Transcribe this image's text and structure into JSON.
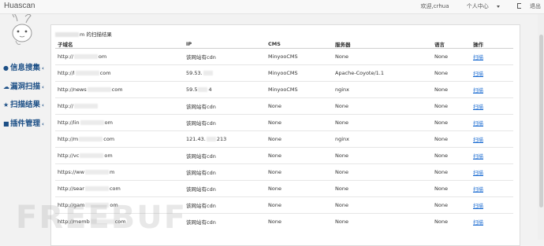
{
  "navbar": {
    "brand": "Huascan",
    "welcome": "欢迎,crhua",
    "user_center": "个人中心",
    "logout": "退出"
  },
  "sidebar": {
    "items": [
      {
        "icon": "globe-icon",
        "label": "信息搜集",
        "glyph": "●"
      },
      {
        "icon": "bug-icon",
        "label": "漏洞扫描",
        "glyph": "☁"
      },
      {
        "icon": "star-icon",
        "label": "扫描结果",
        "glyph": "★"
      },
      {
        "icon": "grid-icon",
        "label": "插件管理",
        "glyph": "■"
      }
    ]
  },
  "panel": {
    "title_suffix": "m 的扫描结果"
  },
  "table": {
    "headers": [
      "子域名",
      "IP",
      "CMS",
      "服务器",
      "语言",
      "操作"
    ],
    "rows": [
      {
        "domain_pre": "http://",
        "domain_post": "om",
        "ip_pre": "该网站有cdn",
        "ip_post": "",
        "cms": "MinyooCMS",
        "server": "None",
        "lang": "None",
        "action": "扫描"
      },
      {
        "domain_pre": "http://l",
        "domain_post": "com",
        "ip_pre": "59.53.",
        "ip_post": "",
        "cms": "MinyooCMS",
        "server": "Apache-Coyote/1.1",
        "lang": "None",
        "action": "扫描"
      },
      {
        "domain_pre": "http://news",
        "domain_post": "com",
        "ip_pre": "59.5",
        "ip_post": "4",
        "cms": "MinyooCMS",
        "server": "nginx",
        "lang": "None",
        "action": "扫描"
      },
      {
        "domain_pre": "http://",
        "domain_post": "",
        "ip_pre": "该网站有cdn",
        "ip_post": "",
        "cms": "None",
        "server": "None",
        "lang": "None",
        "action": "扫描"
      },
      {
        "domain_pre": "http://lin",
        "domain_post": "om",
        "ip_pre": "该网站有cdn",
        "ip_post": "",
        "cms": "None",
        "server": "None",
        "lang": "None",
        "action": "扫描"
      },
      {
        "domain_pre": "http://m",
        "domain_post": "com",
        "ip_pre": "121.43.",
        "ip_post": "213",
        "cms": "None",
        "server": "nginx",
        "lang": "None",
        "action": "扫描"
      },
      {
        "domain_pre": "http://vc",
        "domain_post": "om",
        "ip_pre": "该网站有cdn",
        "ip_post": "",
        "cms": "None",
        "server": "None",
        "lang": "None",
        "action": "扫描"
      },
      {
        "domain_pre": "https://ww",
        "domain_post": "m",
        "ip_pre": "该网站有cdn",
        "ip_post": "",
        "cms": "None",
        "server": "None",
        "lang": "None",
        "action": "扫描"
      },
      {
        "domain_pre": "http://sear",
        "domain_post": "com",
        "ip_pre": "该网站有cdn",
        "ip_post": "",
        "cms": "None",
        "server": "None",
        "lang": "None",
        "action": "扫描"
      },
      {
        "domain_pre": "http://gam",
        "domain_post": "om",
        "ip_pre": "该网站有cdn",
        "ip_post": "",
        "cms": "None",
        "server": "None",
        "lang": "None",
        "action": "扫描"
      },
      {
        "domain_pre": "http://memb",
        "domain_post": "com",
        "ip_pre": "该网站有cdn",
        "ip_post": "",
        "cms": "None",
        "server": "None",
        "lang": "None",
        "action": "扫描"
      }
    ]
  },
  "watermark": "FREEBUF"
}
